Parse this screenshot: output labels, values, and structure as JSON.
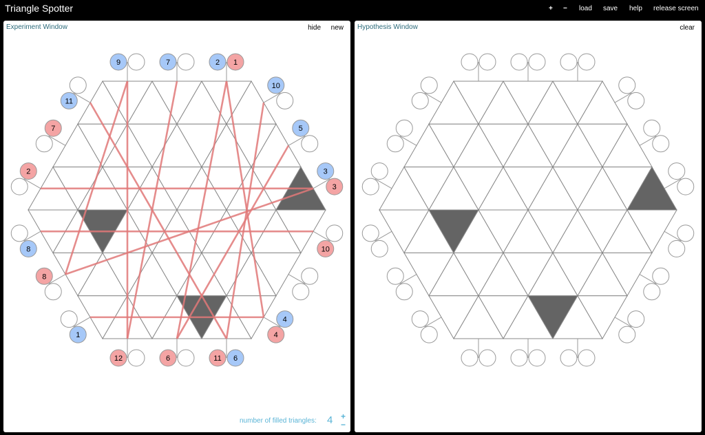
{
  "app": {
    "title": "Triangle Spotter"
  },
  "toolbar": {
    "plus": "+",
    "minus": "−",
    "load": "load",
    "save": "save",
    "help": "help",
    "release": "release screen"
  },
  "experiment": {
    "title": "Experiment Window",
    "hide_label": "hide",
    "new_label": "new",
    "count_label": "number of filled triangles:",
    "count_value": "4",
    "count_plus": "+",
    "count_minus": "−",
    "colors": {
      "beam": "#e07878",
      "blue_port": "#a6c8f8",
      "red_port": "#f4a4a4",
      "filled": "#646464",
      "grid": "#888888"
    }
  },
  "hypothesis": {
    "title": "Hypothesis Window",
    "clear_label": "clear"
  },
  "board": {
    "filled_triangles": [
      {
        "row": 2,
        "col": 10
      },
      {
        "row": 3,
        "col": 2
      },
      {
        "row": 5,
        "col": 4
      },
      {
        "row": 5,
        "col": 8
      }
    ],
    "ports": [
      {
        "side": 0,
        "slot": 0,
        "blue": "9",
        "red": ""
      },
      {
        "side": 0,
        "slot": 1,
        "blue": "7",
        "red": ""
      },
      {
        "side": 0,
        "slot": 2,
        "blue": "2",
        "red": "1"
      },
      {
        "side": 1,
        "slot": 0,
        "blue": "10",
        "red": ""
      },
      {
        "side": 1,
        "slot": 1,
        "blue": "5",
        "red": ""
      },
      {
        "side": 1,
        "slot": 2,
        "blue": "3",
        "red": "3"
      },
      {
        "side": 2,
        "slot": 0,
        "blue": "",
        "red": "10"
      },
      {
        "side": 2,
        "slot": 1,
        "blue": "",
        "red": ""
      },
      {
        "side": 2,
        "slot": 2,
        "blue": "4",
        "red": "4"
      },
      {
        "side": 3,
        "slot": 0,
        "blue": "6",
        "red": "11"
      },
      {
        "side": 3,
        "slot": 1,
        "blue": "",
        "red": "6"
      },
      {
        "side": 3,
        "slot": 2,
        "blue": "",
        "red": "12"
      },
      {
        "side": 4,
        "slot": 0,
        "blue": "1",
        "red": ""
      },
      {
        "side": 4,
        "slot": 1,
        "blue": "",
        "red": "8"
      },
      {
        "side": 4,
        "slot": 2,
        "blue": "8",
        "red": ""
      },
      {
        "side": 5,
        "slot": 0,
        "blue": "",
        "red": "2"
      },
      {
        "side": 5,
        "slot": 1,
        "blue": "",
        "red": "7"
      },
      {
        "side": 5,
        "slot": 2,
        "blue": "11",
        "red": ""
      }
    ],
    "beams": [
      {
        "from": [
          0,
          0
        ],
        "to": [
          4,
          1
        ]
      },
      {
        "from": [
          0,
          1
        ],
        "to": [
          3,
          2
        ]
      },
      {
        "from": [
          0,
          2
        ],
        "to": [
          2,
          2
        ]
      },
      {
        "from": [
          1,
          0
        ],
        "to": [
          3,
          0
        ]
      },
      {
        "from": [
          1,
          1
        ],
        "to": [
          3,
          1
        ]
      },
      {
        "from": [
          1,
          2
        ],
        "to": [
          5,
          0
        ]
      },
      {
        "from": [
          2,
          0
        ],
        "to": [
          4,
          2
        ]
      },
      {
        "from": [
          2,
          2
        ],
        "to": [
          4,
          0
        ]
      },
      {
        "from": [
          3,
          0
        ],
        "to": [
          5,
          2
        ]
      },
      {
        "from": [
          3,
          1
        ],
        "to": [
          0,
          2
        ]
      },
      {
        "from": [
          3,
          2
        ],
        "to": [
          0,
          0
        ]
      },
      {
        "from": [
          4,
          1
        ],
        "to": [
          1,
          2
        ]
      }
    ]
  }
}
